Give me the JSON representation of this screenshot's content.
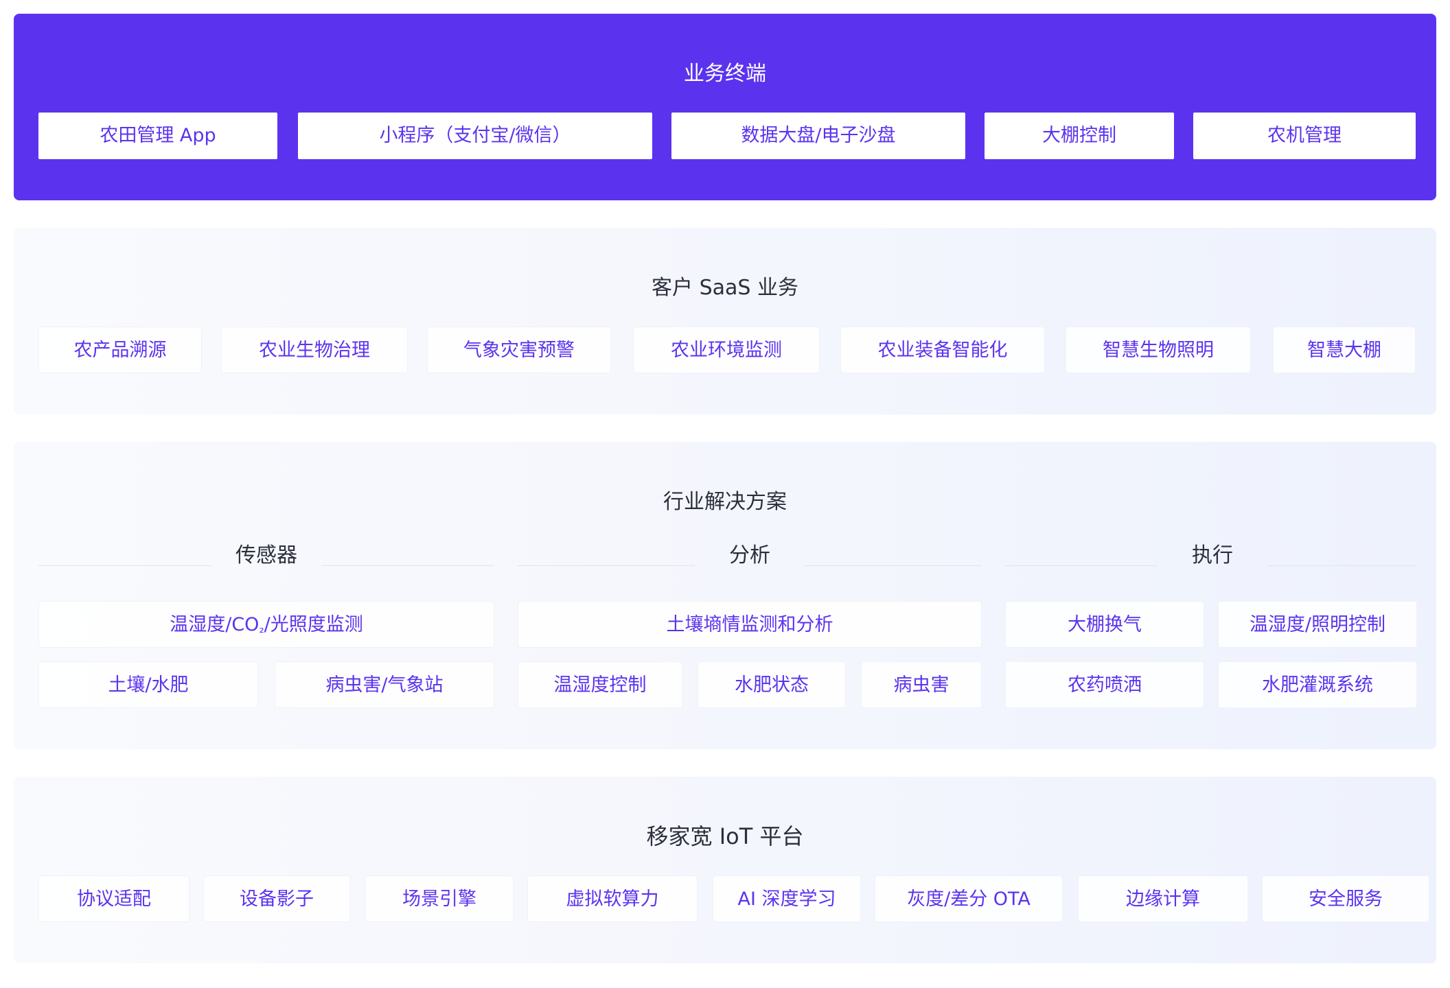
{
  "terminal": {
    "title": "业务终端",
    "items": [
      "农田管理 App",
      "小程序（支付宝/微信）",
      "数据大盘/电子沙盘",
      "大棚控制",
      "农机管理"
    ]
  },
  "saas": {
    "title": "客户 SaaS 业务",
    "items": [
      "农产品溯源",
      "农业生物治理",
      "气象灾害预警",
      "农业环境监测",
      "农业装备智能化",
      "智慧生物照明",
      "智慧大棚"
    ]
  },
  "solutions": {
    "title": "行业解决方案",
    "groups": [
      {
        "title": "传感器",
        "items": [
          "温湿度/CO",
          "₂",
          "/光照度监测",
          "土壤/水肥",
          "病虫害/气象站"
        ]
      },
      {
        "title": "分析",
        "items": [
          "土壤墒情监测和分析",
          "温湿度控制",
          "水肥状态",
          "病虫害"
        ]
      },
      {
        "title": "执行",
        "items": [
          "大棚换气",
          "温湿度/照明控制",
          "农药喷洒",
          "水肥灌溉系统"
        ]
      }
    ]
  },
  "iot": {
    "title": "移家宽 IoT 平台",
    "items": [
      "协议适配",
      "设备影子",
      "场景引擎",
      "虚拟软算力",
      "AI 深度学习",
      "灰度/差分 OTA",
      "边缘计算",
      "安全服务"
    ]
  },
  "colors": {
    "accent": "#5b33ee",
    "text": "#2b2f3c",
    "panel_bg": "#f4f6fd"
  }
}
